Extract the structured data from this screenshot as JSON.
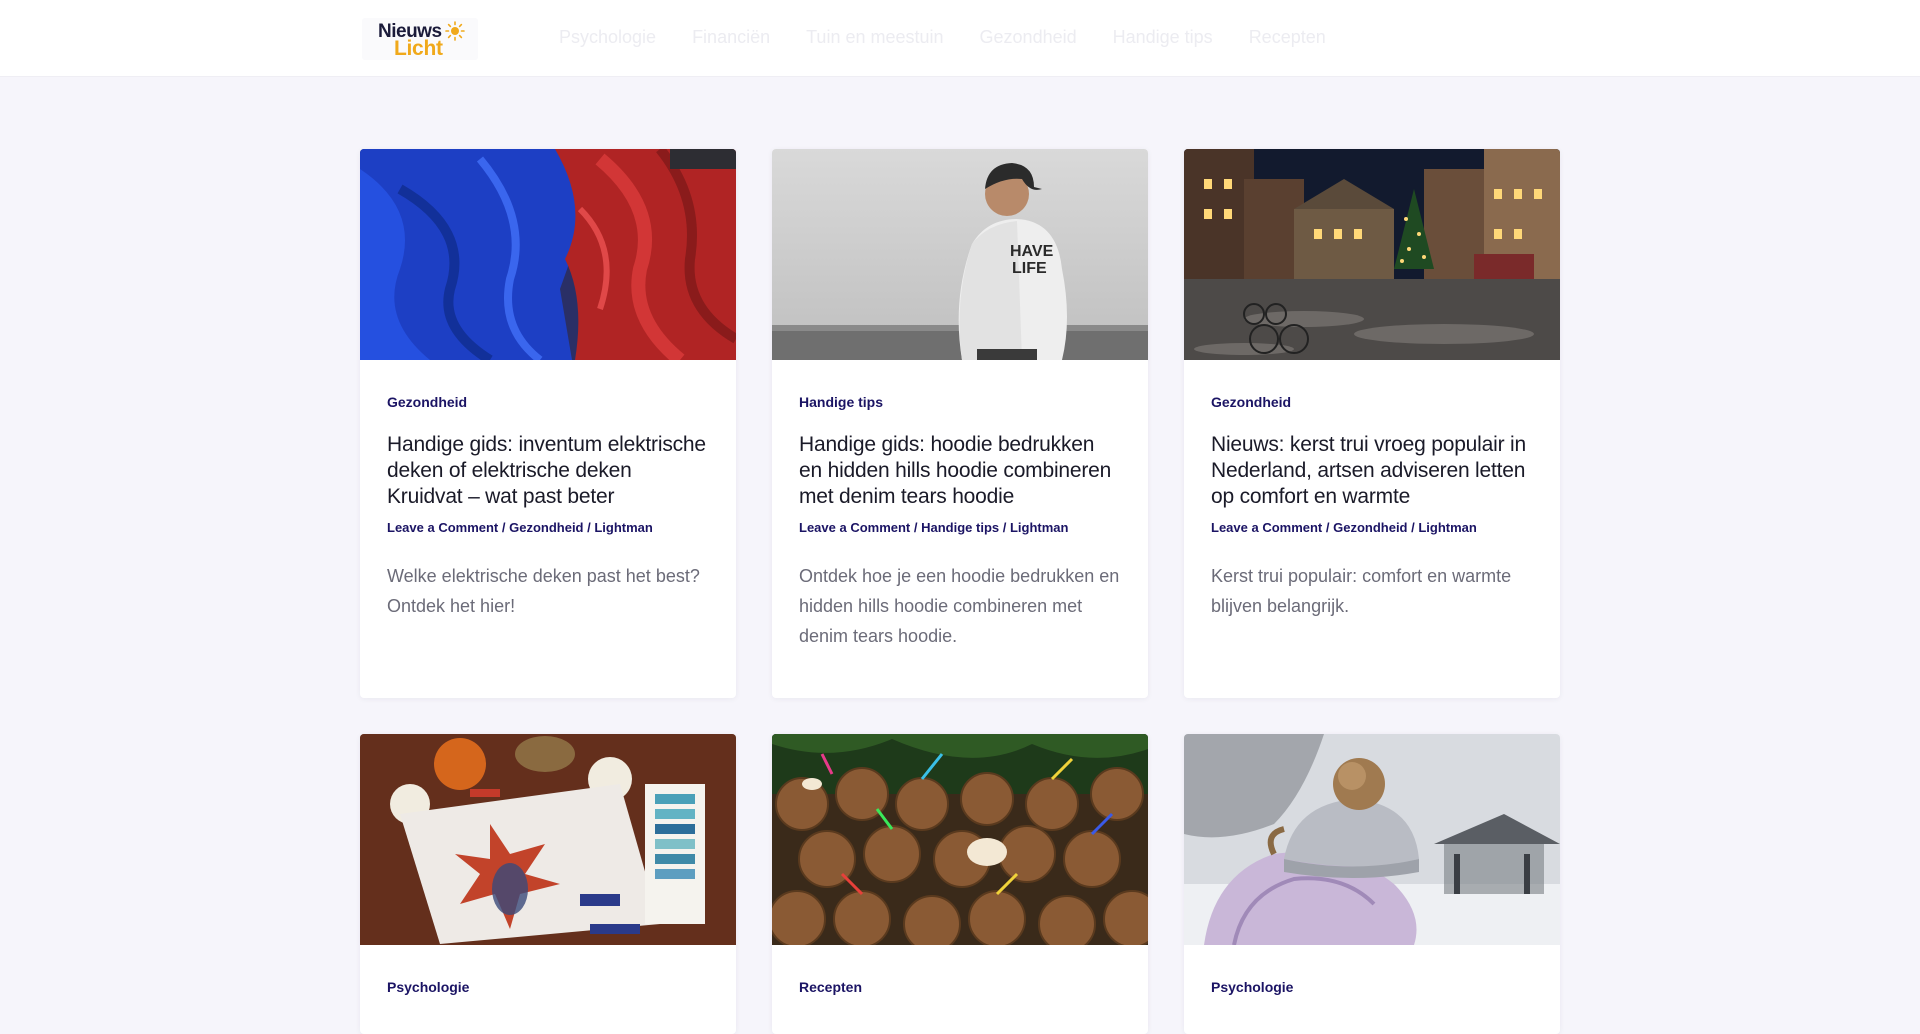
{
  "header": {
    "logo_line1": "Nieuws",
    "logo_line2": "Licht",
    "nav": [
      "Psychologie",
      "Financiën",
      "Tuin en meestuin",
      "Gezondheid",
      "Handige tips",
      "Recepten"
    ]
  },
  "posts": [
    {
      "category": "Gezondheid",
      "title": "Handige gids: inventum elektrische deken of elektrische deken Kruidvat – wat past beter",
      "meta": [
        "Leave a Comment",
        "Gezondheid",
        "Lightman"
      ],
      "excerpt": "Welke elektrische deken past het best? Ontdek het hier!",
      "image": "blue-and-red-blankets"
    },
    {
      "category": "Handige tips",
      "title": "Handige gids: hoodie bedrukken en hidden hills hoodie combineren met denim tears hoodie",
      "meta": [
        "Leave a Comment",
        "Handige tips",
        "Lightman"
      ],
      "excerpt": "Ontdek hoe je een hoodie bedrukken en hidden hills hoodie combineren met denim tears hoodie.",
      "image": "man-in-white-hoodie"
    },
    {
      "category": "Gezondheid",
      "title": "Nieuws: kerst trui vroeg populair in Nederland, artsen adviseren letten op comfort en warmte",
      "meta": [
        "Leave a Comment",
        "Gezondheid",
        "Lightman"
      ],
      "excerpt": "Kerst trui populair: comfort en warmte blijven belangrijk.",
      "image": "christmas-town-square-night"
    },
    {
      "category": "Psychologie",
      "image": "autumn-watercolor-painting"
    },
    {
      "category": "Recepten",
      "image": "coconuts-with-straws"
    },
    {
      "category": "Psychologie",
      "image": "winter-hat-in-snow"
    }
  ],
  "colors": {
    "accent": "#1b1464",
    "logo_orange": "#f0a91b",
    "page_bg": "#f6f5fb"
  }
}
